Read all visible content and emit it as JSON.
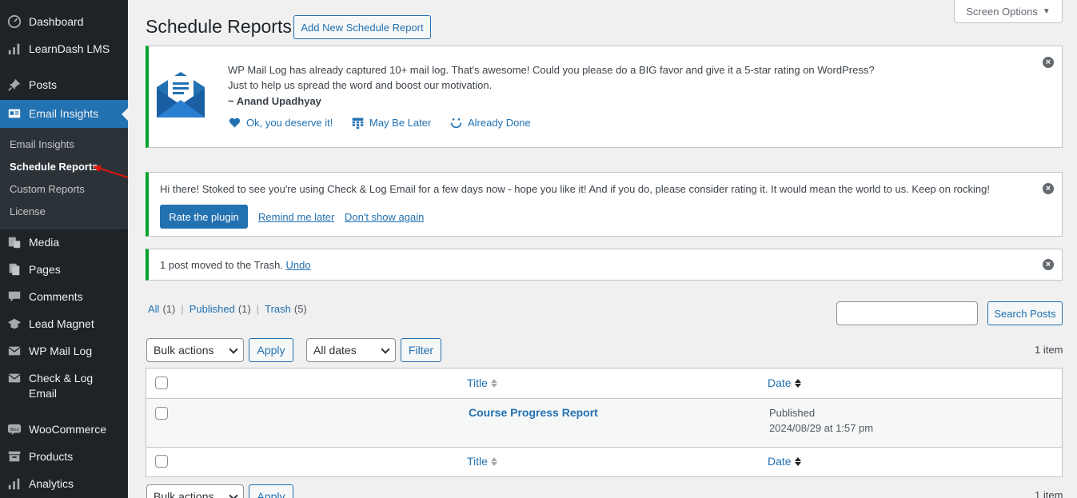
{
  "sidebar": {
    "items": [
      {
        "label": "Dashboard",
        "icon": "dashboard-icon"
      },
      {
        "label": "LearnDash LMS",
        "icon": "learndash-icon"
      },
      {
        "label": "Posts",
        "icon": "pin-icon"
      },
      {
        "label": "Email Insights",
        "icon": "email-insights-icon"
      },
      {
        "label": "Media",
        "icon": "media-icon"
      },
      {
        "label": "Pages",
        "icon": "pages-icon"
      },
      {
        "label": "Comments",
        "icon": "comments-icon"
      },
      {
        "label": "Lead Magnet",
        "icon": "graduation-cap-icon"
      },
      {
        "label": "WP Mail Log",
        "icon": "mail-icon"
      },
      {
        "label_line1": "Check & Log",
        "label_line2": "Email",
        "icon": "mail-icon"
      },
      {
        "label": "WooCommerce",
        "icon": "woocommerce-icon"
      },
      {
        "label": "Products",
        "icon": "archive-icon"
      },
      {
        "label": "Analytics",
        "icon": "chart-icon"
      }
    ],
    "submenu": [
      "Email Insights",
      "Schedule Reports",
      "Custom Reports",
      "License"
    ]
  },
  "header": {
    "title": "Schedule Reports",
    "add_new": "Add New Schedule Report",
    "screen_options": "Screen Options"
  },
  "notice1": {
    "line1": "WP Mail Log has already captured 10+ mail log. That's awesome! Could you please do a BIG favor and give it a 5-star rating on WordPress?",
    "line2": "Just to help us spread the word and boost our motivation.",
    "author": "~ Anand Upadhyay",
    "actions": [
      "Ok, you deserve it!",
      "May Be Later",
      "Already Done"
    ]
  },
  "notice2": {
    "text": "Hi there! Stoked to see you're using Check & Log Email for a few days now - hope you like it! And if you do, please consider rating it. It would mean the world to us. Keep on rocking!",
    "rate_button": "Rate the plugin",
    "remind": "Remind me later",
    "dont_show": "Don't show again"
  },
  "notice3": {
    "text": "1 post moved to the Trash.",
    "undo": "Undo"
  },
  "filters": {
    "all": "All",
    "all_count": "(1)",
    "published": "Published",
    "published_count": "(1)",
    "trash": "Trash",
    "trash_count": "(5)",
    "sep": "|",
    "search_button": "Search Posts",
    "bulk_actions": "Bulk actions",
    "apply": "Apply",
    "all_dates": "All dates",
    "filter": "Filter",
    "item_count": "1 item"
  },
  "table": {
    "col_title": "Title",
    "col_date": "Date",
    "rows": [
      {
        "title": "Course Progress Report",
        "status": "Published",
        "date": "2024/08/29 at 1:57 pm"
      }
    ]
  },
  "colors": {
    "sidebar_bg": "#1d2327",
    "accent": "#2271b1",
    "notice_border": "#00a32a"
  }
}
